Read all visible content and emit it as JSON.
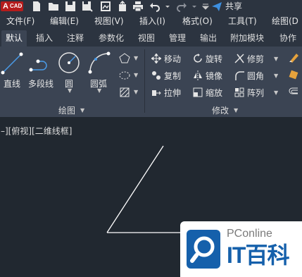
{
  "app": {
    "logo_letter": "A",
    "logo_text": "CAD",
    "share_label": "共享"
  },
  "quick_access": [
    "new-icon",
    "open-icon",
    "save-icon",
    "save-as-icon",
    "plot-icon",
    "publish-icon",
    "print-icon",
    "undo-icon",
    "redo-icon",
    "more-icon",
    "share-icon"
  ],
  "menu": [
    "文件(F)",
    "编辑(E)",
    "视图(V)",
    "插入(I)",
    "格式(O)",
    "工具(T)",
    "绘图(D"
  ],
  "tabs": [
    "默认",
    "插入",
    "注释",
    "参数化",
    "视图",
    "管理",
    "输出",
    "附加模块",
    "协作"
  ],
  "draw_panel": {
    "title": "绘图",
    "tools": [
      "直线",
      "多段线",
      "圆",
      "圆弧"
    ]
  },
  "modify_panel": {
    "title": "修改",
    "rows": [
      [
        "移动",
        "旋转",
        "修剪"
      ],
      [
        "复制",
        "镜像",
        "圆角"
      ],
      [
        "拉伸",
        "缩放",
        "阵列"
      ]
    ]
  },
  "viewport": {
    "label": "–][俯视][二维线框]"
  },
  "watermark": {
    "brand": "PConline",
    "name": "IT百科"
  },
  "colors": {
    "background": "#212830",
    "ribbon": "#3b4453",
    "accent": "#b51c1c",
    "watermark_blue": "#1560ab"
  }
}
